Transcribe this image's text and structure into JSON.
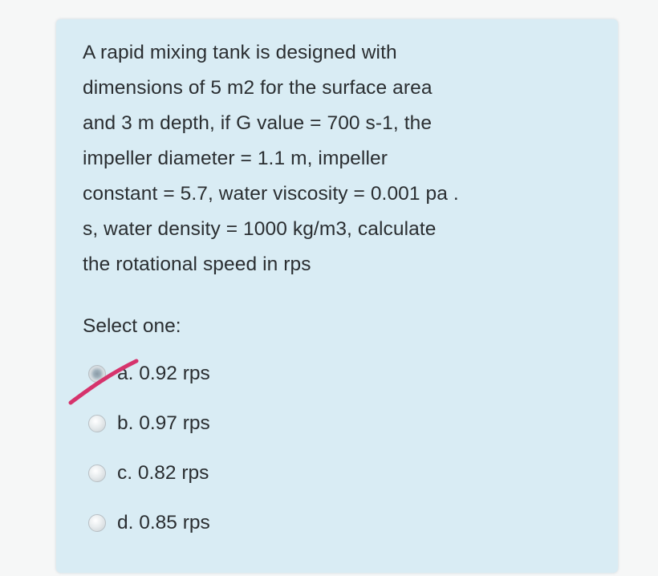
{
  "question": {
    "lines": [
      "A rapid mixing tank is designed with",
      "dimensions of 5 m2 for the surface area",
      "and 3 m depth, if G value = 700 s-1, the",
      "impeller diameter = 1.1 m, impeller",
      "constant = 5.7, water viscosity = 0.001 pa .",
      "s, water density = 1000 kg/m3, calculate",
      "the rotational speed in rps"
    ]
  },
  "prompt": "Select one:",
  "options": [
    {
      "label": "a. 0.92 rps",
      "selected": true
    },
    {
      "label": "b. 0.97 rps",
      "selected": false
    },
    {
      "label": "c. 0.82 rps",
      "selected": false
    },
    {
      "label": "d. 0.85 rps",
      "selected": false
    }
  ],
  "colors": {
    "card_background": "#d9ecf4",
    "text": "#2a2e31",
    "check_mark": "#d6336c"
  }
}
